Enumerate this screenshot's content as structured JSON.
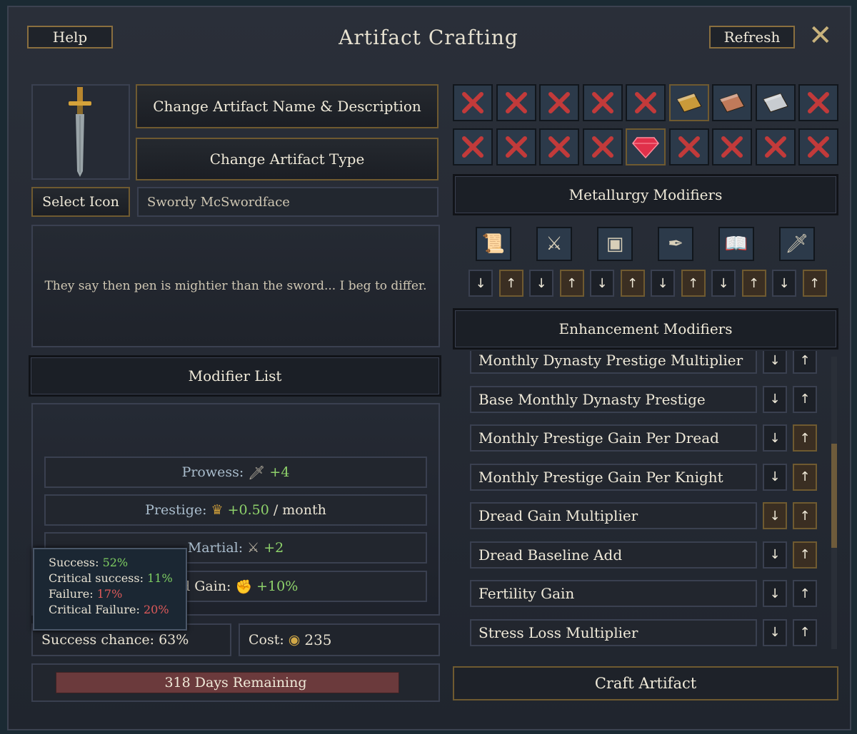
{
  "window": {
    "title": "Artifact Crafting",
    "help_label": "Help",
    "refresh_label": "Refresh",
    "close_glyph": "✕"
  },
  "artifact": {
    "change_name_label": "Change Artifact Name & Description",
    "change_type_label": "Change Artifact Type",
    "select_icon_label": "Select Icon",
    "name": "Swordy McSwordface",
    "description": "They say then pen is mightier than the sword... I beg to differ."
  },
  "modifier_list": {
    "header": "Modifier List",
    "rows": [
      {
        "label": "Prowess:",
        "icon": "prowess-icon",
        "value": "+4",
        "unit": ""
      },
      {
        "label": "Prestige:",
        "icon": "crown-icon",
        "value": "+0.50",
        "unit": "/ month"
      },
      {
        "label": "Martial:",
        "icon": "crossed-swords-icon",
        "value": "+2",
        "unit": ""
      },
      {
        "label": "ad Gain:",
        "icon": "gauntlet-icon",
        "value": "+10%",
        "unit": ""
      }
    ]
  },
  "tooltip": {
    "success_label": "Success:",
    "success_value": "52%",
    "crit_success_label": "Critical success:",
    "crit_success_value": "11%",
    "failure_label": "Failure:",
    "failure_value": "17%",
    "crit_failure_label": "Critical Failure:",
    "crit_failure_value": "20%"
  },
  "stats": {
    "success_chance": "Success chance: 63%",
    "cost_label": "Cost:",
    "cost_value": "235",
    "days_remaining": "318 Days Remaining",
    "progress_fraction": 0.95
  },
  "materials": {
    "row1": [
      "x",
      "x",
      "x",
      "x",
      "x",
      "gold-ingot",
      "copper-ingot",
      "silver-ingot",
      "x"
    ],
    "row2": [
      "x",
      "x",
      "x",
      "x",
      "ruby",
      "x",
      "x",
      "x",
      "x"
    ],
    "selected": [
      5,
      13
    ]
  },
  "metallurgy": {
    "header": "Metallurgy Modifiers",
    "icons": [
      "scroll-icon",
      "crossed-swords-icon",
      "chest-icon",
      "quill-icon",
      "book-icon",
      "prowess-icon"
    ],
    "arrows": [
      "↓",
      "↑",
      "↓",
      "↑",
      "↓",
      "↑",
      "↓",
      "↑",
      "↓",
      "↑",
      "↓",
      "↑"
    ]
  },
  "enhancement": {
    "header": "Enhancement Modifiers",
    "rows": [
      {
        "label": "Monthly Dynasty Prestige Multiplier",
        "down": "↓",
        "up": "↑",
        "up_active": false
      },
      {
        "label": "Base Monthly Dynasty Prestige",
        "down": "↓",
        "up": "↑",
        "up_active": false
      },
      {
        "label": "Monthly Prestige Gain Per Dread",
        "down": "↓",
        "up": "↑",
        "up_active": true
      },
      {
        "label": "Monthly Prestige Gain Per Knight",
        "down": "↓",
        "up": "↑",
        "up_active": true
      },
      {
        "label": "Dread Gain Multiplier",
        "down": "↓",
        "up": "↑",
        "up_active": true,
        "down_active": true
      },
      {
        "label": "Dread Baseline Add",
        "down": "↓",
        "up": "↑",
        "up_active": true
      },
      {
        "label": "Fertility Gain",
        "down": "↓",
        "up": "↑",
        "up_active": false
      },
      {
        "label": "Stress Loss Multiplier",
        "down": "↓",
        "up": "↑",
        "up_active": false
      }
    ]
  },
  "craft_label": "Craft Artifact"
}
